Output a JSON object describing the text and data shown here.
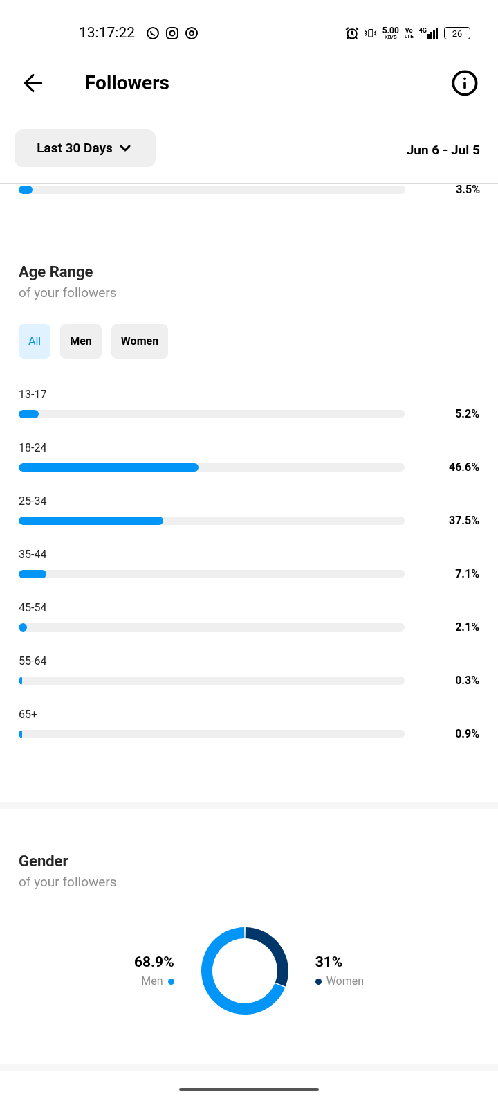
{
  "status_bar": {
    "time": "13:17:22",
    "speed": "5.00",
    "speed_unit": "KB/S",
    "volte_top": "Vo",
    "volte_bottom": "LTE",
    "network": "4G",
    "battery": "26"
  },
  "header": {
    "title": "Followers"
  },
  "filter": {
    "label": "Last 30 Days",
    "date_range": "Jun 6 - Jul 5"
  },
  "previous_bar": {
    "level": 0.035,
    "reading": "3.5%"
  },
  "age_range": {
    "title": "Age Range",
    "subtitle": "of your followers",
    "tabs": [
      {
        "label": "All",
        "selected": true
      },
      {
        "label": "Men",
        "selected": false
      },
      {
        "label": "Women",
        "selected": false
      }
    ],
    "rows": [
      {
        "label": "13-17",
        "level": 0.052,
        "reading": "5.2%"
      },
      {
        "label": "18-24",
        "level": 0.466,
        "reading": "46.6%"
      },
      {
        "label": "25-34",
        "level": 0.375,
        "reading": "37.5%"
      },
      {
        "label": "35-44",
        "level": 0.071,
        "reading": "7.1%"
      },
      {
        "label": "45-54",
        "level": 0.021,
        "reading": "2.1%"
      },
      {
        "label": "55-64",
        "level": 0.003,
        "reading": "0.3%"
      },
      {
        "label": "65+",
        "level": 0.009,
        "reading": "0.9%"
      }
    ]
  },
  "gender": {
    "subtitle": "of your followers",
    "legend": [
      {
        "color": "#0095f6"
      },
      {
        "color": "#00376b"
      }
    ],
    "chart_data": {
      "type": "donut",
      "title": "Gender",
      "categories": [
        "Men",
        "Women"
      ],
      "values": [
        68.9,
        31
      ],
      "value_labels": [
        "68.9%",
        "31%"
      ]
    }
  }
}
